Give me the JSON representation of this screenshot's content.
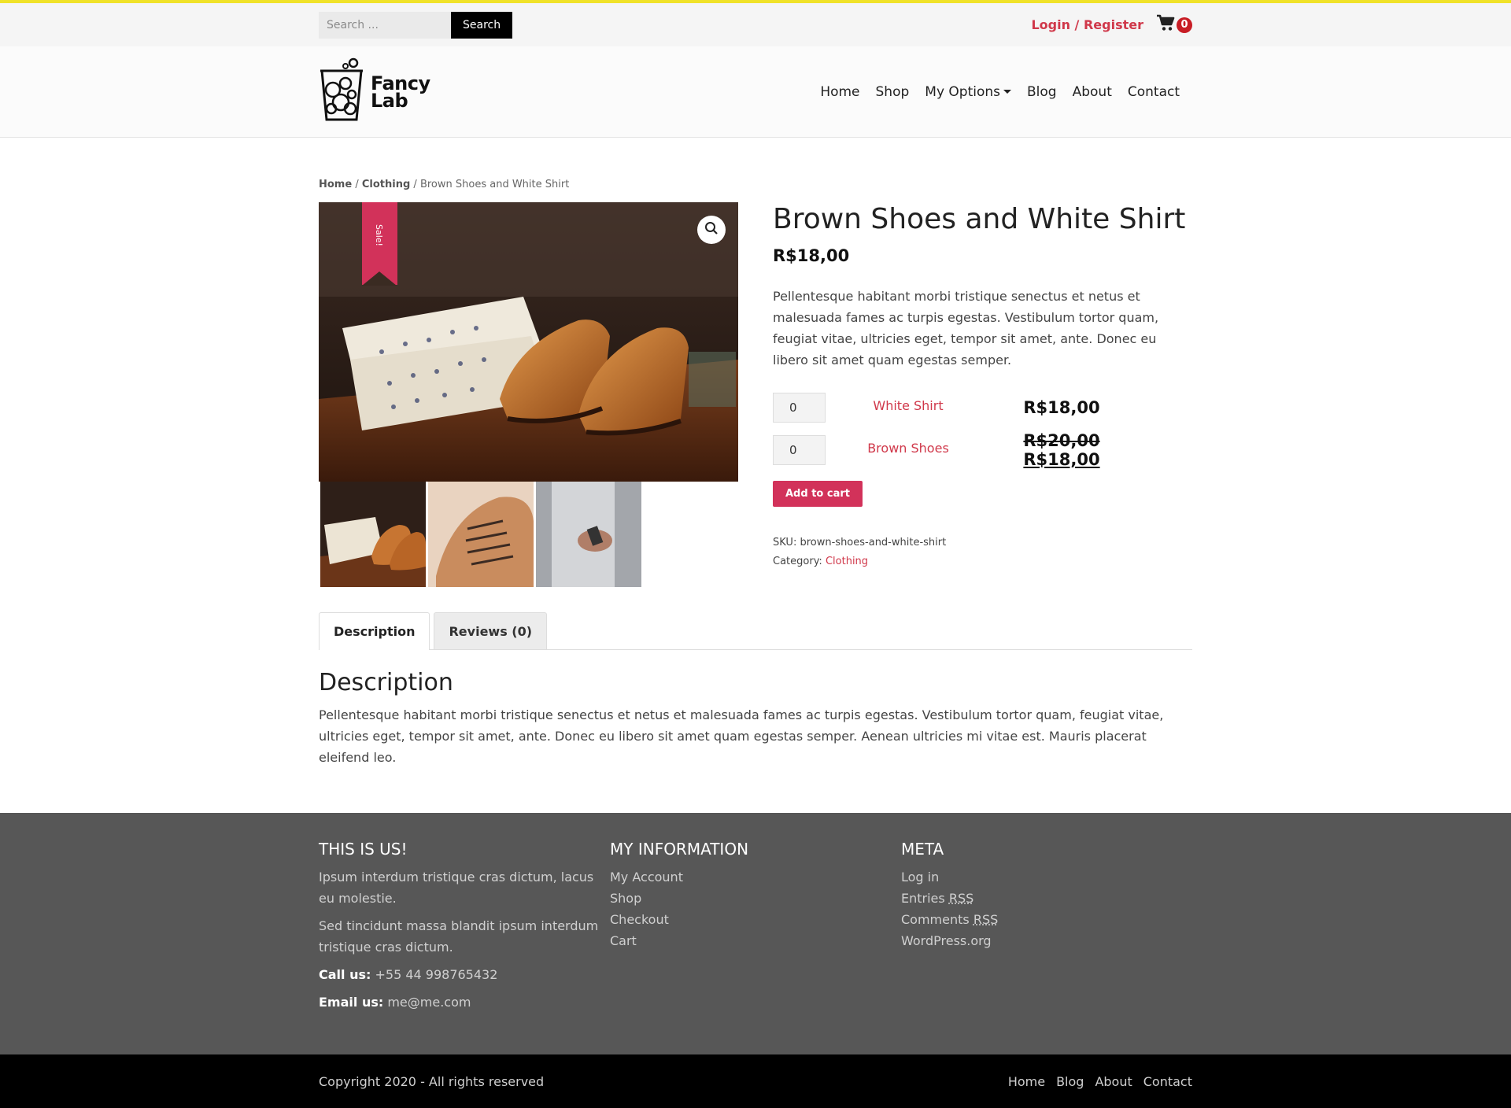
{
  "topbar": {
    "search_placeholder": "Search ...",
    "search_button": "Search",
    "login_label": "Login / Register",
    "cart_count": "0"
  },
  "header": {
    "logo_line1": "Fancy",
    "logo_line2": "Lab",
    "nav": [
      {
        "label": "Home"
      },
      {
        "label": "Shop"
      },
      {
        "label": "My Options"
      },
      {
        "label": "Blog"
      },
      {
        "label": "About"
      },
      {
        "label": "Contact"
      }
    ]
  },
  "breadcrumb": {
    "home": "Home",
    "sep1": "/",
    "category": "Clothing",
    "sep2": "/",
    "current": "Brown Shoes and White Shirt"
  },
  "product": {
    "sale_label": "Sale!",
    "title": "Brown Shoes and White Shirt",
    "price": "R$18,00",
    "short_description": "Pellentesque habitant morbi tristique senectus et netus et malesuada fames ac turpis egestas. Vestibulum tortor quam, feugiat vitae, ultricies eget, tempor sit amet, ante. Donec eu libero sit amet quam egestas semper.",
    "group_items": [
      {
        "qty": "0",
        "name": "White Shirt",
        "price": "R$18,00",
        "old_price": ""
      },
      {
        "qty": "0",
        "name": "Brown Shoes",
        "price": "R$18,00",
        "old_price": "R$20,00"
      }
    ],
    "add_to_cart": "Add to cart",
    "sku_label": "SKU:",
    "sku_value": "brown-shoes-and-white-shirt",
    "category_label": "Category:",
    "category_value": "Clothing"
  },
  "tabs": {
    "description": "Description",
    "reviews": "Reviews (0)"
  },
  "description": {
    "heading": "Description",
    "text": "Pellentesque habitant morbi tristique senectus et netus et malesuada fames ac turpis egestas. Vestibulum tortor quam, feugiat vitae, ultricies eget, tempor sit amet, ante. Donec eu libero sit amet quam egestas semper. Aenean ultricies mi vitae est. Mauris placerat eleifend leo."
  },
  "footer": {
    "col1": {
      "title": "THIS IS US!",
      "p1": "Ipsum interdum tristique cras dictum, lacus eu molestie.",
      "p2": "Sed tincidunt massa blandit ipsum interdum tristique cras dictum.",
      "call_label": "Call us:",
      "call_value": "+55 44 998765432",
      "email_label": "Email us:",
      "email_value": "me@me.com"
    },
    "col2": {
      "title": "MY INFORMATION",
      "links": [
        "My Account",
        "Shop",
        "Checkout",
        "Cart"
      ]
    },
    "col3": {
      "title": "META",
      "login": "Log in",
      "entries_prefix": "Entries",
      "comments_prefix": "Comments",
      "rss": "RSS",
      "wordpress": "WordPress.org"
    }
  },
  "bottombar": {
    "copyright": "Copyright 2020 - All rights reserved",
    "nav": [
      "Home",
      "Blog",
      "About",
      "Contact"
    ]
  },
  "colors": {
    "accent": "#d2325a",
    "link_red": "#d0384a",
    "top_border": "#f0e229",
    "footer_bg": "#575757"
  }
}
